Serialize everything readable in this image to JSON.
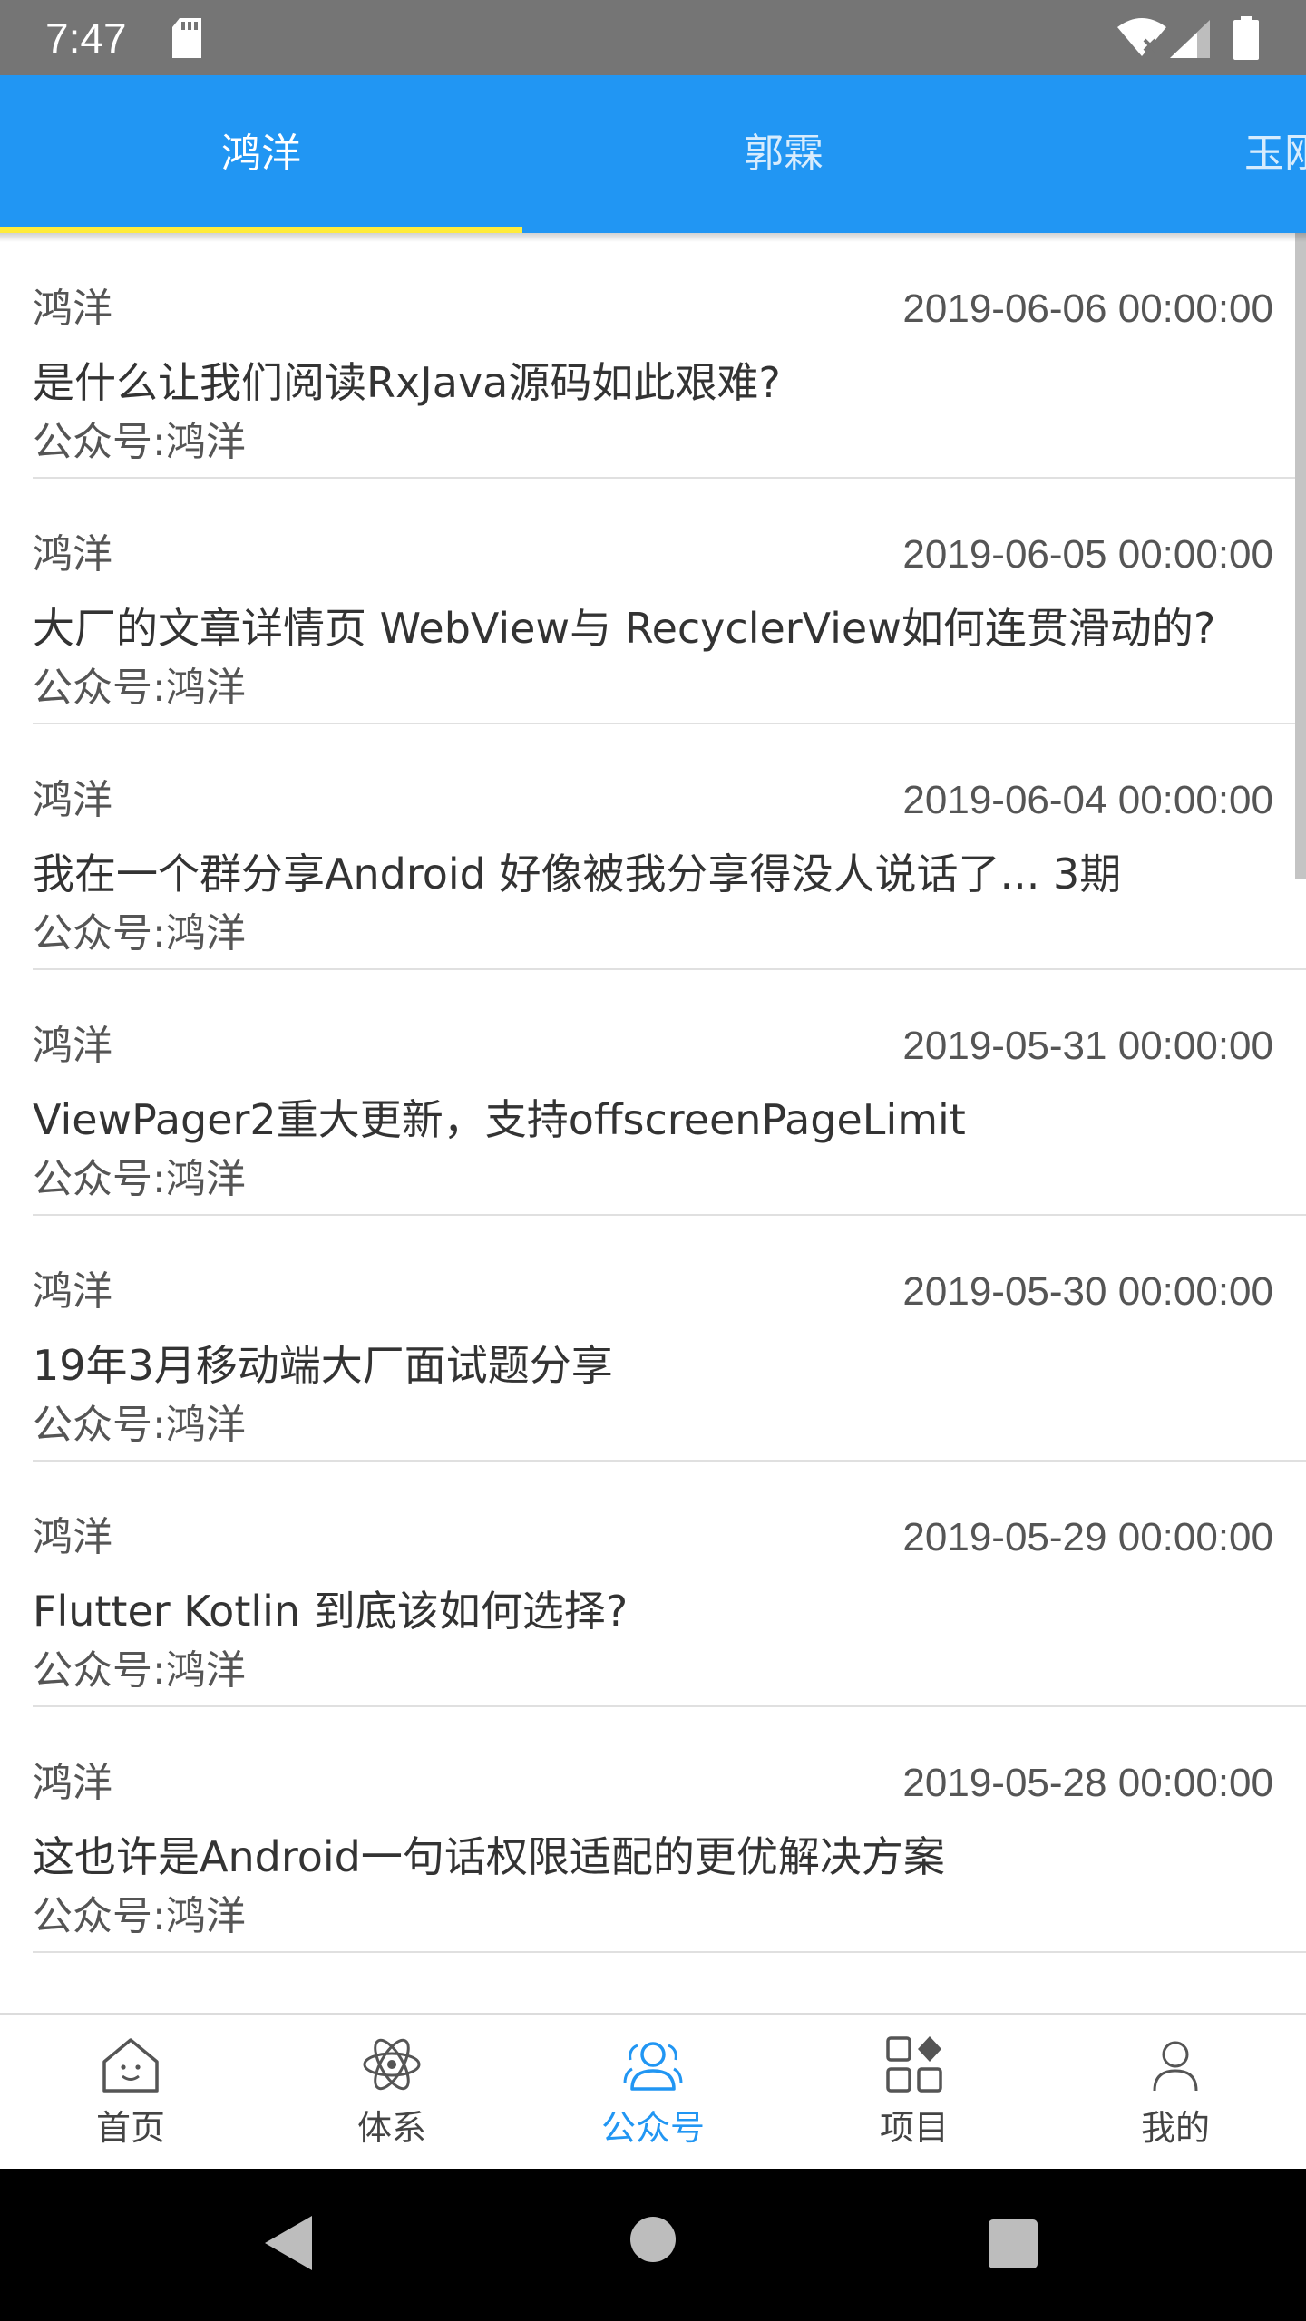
{
  "status_bar": {
    "time": "7:47"
  },
  "tabs": [
    {
      "label": "鸿洋",
      "active": true
    },
    {
      "label": "郭霖",
      "active": false
    },
    {
      "label": "玉刚",
      "active": false
    }
  ],
  "articles": [
    {
      "author": "鸿洋",
      "date": "2019-06-06 00:00:00",
      "title": "是什么让我们阅读RxJava源码如此艰难?",
      "source": "公众号:鸿洋"
    },
    {
      "author": "鸿洋",
      "date": "2019-06-05 00:00:00",
      "title": "大厂的文章详情页 WebView与 RecyclerView如何连贯滑动的?",
      "source": "公众号:鸿洋"
    },
    {
      "author": "鸿洋",
      "date": "2019-06-04 00:00:00",
      "title": "我在一个群分享Android 好像被我分享得没人说话了... 3期",
      "source": "公众号:鸿洋"
    },
    {
      "author": "鸿洋",
      "date": "2019-05-31 00:00:00",
      "title": "ViewPager2重大更新，支持offscreenPageLimit",
      "source": "公众号:鸿洋"
    },
    {
      "author": "鸿洋",
      "date": "2019-05-30 00:00:00",
      "title": "19年3月移动端大厂面试题分享",
      "source": "公众号:鸿洋"
    },
    {
      "author": "鸿洋",
      "date": "2019-05-29 00:00:00",
      "title": "Flutter Kotlin 到底该如何选择?",
      "source": "公众号:鸿洋"
    },
    {
      "author": "鸿洋",
      "date": "2019-05-28 00:00:00",
      "title": "这也许是Android一句话权限适配的更优解决方案",
      "source": "公众号:鸿洋"
    }
  ],
  "bottom_nav": [
    {
      "label": "首页",
      "icon": "home-icon",
      "active": false
    },
    {
      "label": "体系",
      "icon": "atom-icon",
      "active": false
    },
    {
      "label": "公众号",
      "icon": "people-icon",
      "active": true
    },
    {
      "label": "项目",
      "icon": "grid-icon",
      "active": false
    },
    {
      "label": "我的",
      "icon": "person-icon",
      "active": false
    }
  ],
  "colors": {
    "primary": "#2196f3",
    "tab_indicator": "#ffeb3b",
    "status_bar": "#757575"
  }
}
